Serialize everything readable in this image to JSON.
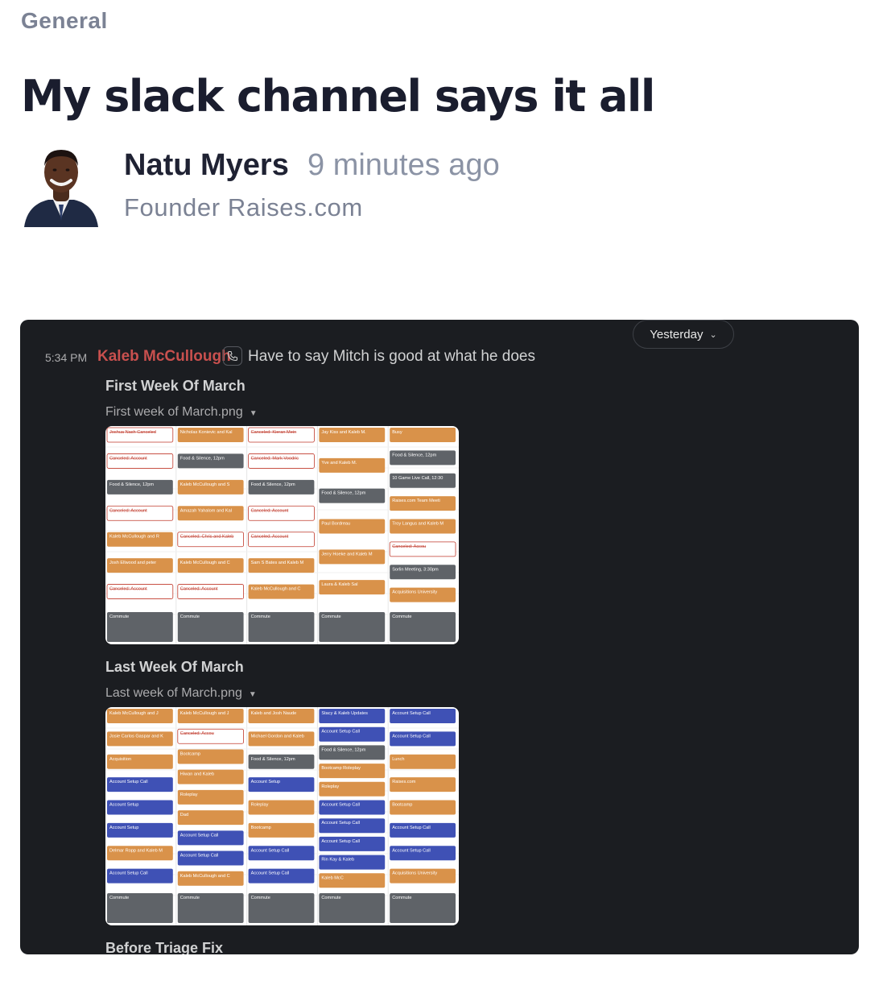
{
  "post": {
    "category": "General",
    "title": "My slack channel says it all",
    "author": {
      "name": "Natu Myers",
      "time": "9 minutes ago",
      "role": "Founder Raises.com"
    }
  },
  "slack": {
    "day_filter": "Yesterday",
    "message": {
      "time": "5:34 PM",
      "user": "Kaleb McCullough",
      "text": "Have to say Mitch is good at what he does",
      "user_color": "#c8504e"
    },
    "attachments": [
      {
        "title": "First Week Of March",
        "file": "First week of March.png"
      },
      {
        "title": "Last Week Of March",
        "file": "Last week of March.png"
      },
      {
        "title": "Before Triage Fix"
      }
    ]
  },
  "calendar_events": {
    "week1": [
      [
        "Joshua Nash Canceled",
        "Canceled: Account",
        "Food & Silence, 12pm",
        "Canceled: Account",
        "Kaleb McCullough and R",
        "Josh Ellwood and peter",
        "Canceled: Account",
        "Commute"
      ],
      [
        "Nicholas Konievic and Kal",
        "Food & Silence, 12pm",
        "Kaleb McCullough and S",
        "Amazah Yahalom and Kal",
        "Canceled: Chris and Kaleb",
        "Kaleb McCullough and C",
        "Canceled: Account",
        "Commute"
      ],
      [
        "Canceled: Kieran Mein",
        "Canceled: Mark Voodric",
        "Food & Silence, 12pm",
        "Canceled: Account",
        "Canceled: Account",
        "Sam S Bates and Kaleb M",
        "Kaleb McCullough and C",
        "Commute"
      ],
      [
        "Jay Kiss and Kaleb M.",
        "Yve and Kaleb M.",
        "Food & Silence, 12pm",
        "Paul Bordreau",
        "Jerry Hoeke and Kaleb M",
        "Laura & Kaleb Sal",
        "Commute"
      ],
      [
        "Busy",
        "Food & Silence, 12pm",
        "10 Game Live Call, 12:30",
        "Raises.com Team Meeti",
        "Troy Langus and Kaleb M",
        "Canceled: Accou",
        "Sorlin Meeting, 3:30pm",
        "Acquisitions University",
        "Commute"
      ]
    ],
    "week2": [
      [
        "Kaleb McCullough and J",
        "Josie Carlos Gaspar and K",
        "Acquisition",
        "Account Setup Call",
        "Account Setup",
        "Account Setup",
        "Delmar Ropp and Kaleb M",
        "Account Setup Call",
        "Commute"
      ],
      [
        "Kaleb McCullough and J",
        "Canceled: Accou",
        "Bootcamp",
        "Hiwan and Kaleb",
        "Roleplay",
        "Dad",
        "Account Setup Call",
        "Account Setup Call",
        "Kaleb McCullough and C",
        "Commute"
      ],
      [
        "Kaleb and Josh Naude",
        "Michael Gordon and Kaleb",
        "Food & Silence, 12pm",
        "Account Setup",
        "Roleplay",
        "Bootcamp",
        "Account Setup Call",
        "Account Setup Call",
        "Commute"
      ],
      [
        "Stacy & Kaleb Updates",
        "Account Setup Call",
        "Food & Silence, 12pm",
        "Bootcamp Roleplay",
        "Roleplay",
        "Account Setup Call",
        "Account Setup Call",
        "Account Setup Call",
        "Rin Kay & Kaleb",
        "Kaleb McC",
        "Commute"
      ],
      [
        "Account Setup Call",
        "Account Setup Call",
        "Lunch",
        "Raises.com",
        "Bootcamp",
        "Account Setup Call",
        "Account Setup Call",
        "Acquisitions University",
        "Commute"
      ]
    ]
  },
  "colors": {
    "page_bg": "#ffffff",
    "slack_bg": "#1b1d21",
    "event_orange": "#d9924a",
    "event_blue": "#3f51b5",
    "event_gray": "#5f6368",
    "event_red": "#c0392b",
    "event_purple": "#8e24aa"
  }
}
